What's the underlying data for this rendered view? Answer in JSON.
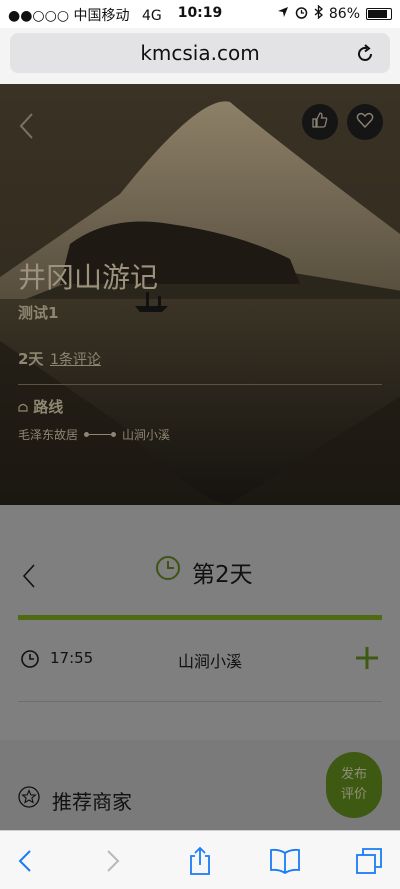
{
  "status_bar": {
    "signal_carrier": "●●○○○ 中国移动",
    "network": "4G",
    "time": "10:19",
    "battery_text": "86%",
    "battery_level": 0.86
  },
  "browser": {
    "url": "kmcsia.com"
  },
  "hero": {
    "title": "井冈山游记",
    "subtitle": "测试1",
    "days": "2天",
    "comments": "1条评论",
    "route_heading": "路线",
    "route_from": "毛泽东故居",
    "route_to": "山涧小溪"
  },
  "day": {
    "title": "第2天",
    "items": [
      {
        "time": "17:55",
        "place": "山涧小溪"
      }
    ]
  },
  "recommend": {
    "title": "推荐商家"
  },
  "fab": {
    "line1": "发布",
    "line2": "评价"
  },
  "colors": {
    "accent": "#4f6a12",
    "fab_bg": "#3e5a12",
    "ios_blue": "#1a7cf5"
  },
  "icons": {
    "back": "chevron-left-icon",
    "like": "thumbs-up-icon",
    "favorite": "heart-icon",
    "clock": "clock-icon",
    "add": "plus-icon",
    "star": "star-icon",
    "share": "share-icon",
    "bookmarks": "book-icon",
    "tabs": "tabs-icon"
  }
}
